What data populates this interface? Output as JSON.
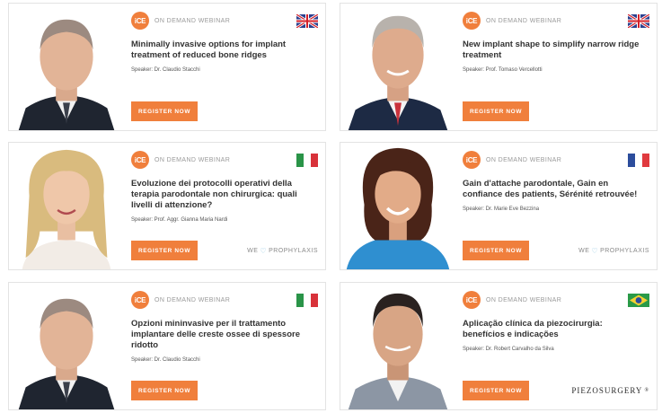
{
  "colors": {
    "accent_orange": "#f07f3c",
    "label_gray": "#9a9a9a",
    "card_border": "#e3e3e3"
  },
  "cards": [
    {
      "badge": "iCE",
      "label": "ON DEMAND WEBINAR",
      "flag": "uk-flag-icon",
      "title": "Minimally invasive options for implant treatment of reduced bone ridges",
      "speaker": "Speaker: Dr. Claudio Stacchi",
      "button": "REGISTER NOW",
      "brand_prefix": "",
      "brand_suffix": ""
    },
    {
      "badge": "iCE",
      "label": "ON DEMAND WEBINAR",
      "flag": "uk-flag-icon",
      "title": "New implant shape to simplify narrow ridge treatment",
      "speaker": "Speaker: Prof. Tomaso Vercellotti",
      "button": "REGISTER NOW",
      "brand_prefix": "",
      "brand_suffix": ""
    },
    {
      "badge": "iCE",
      "label": "ON DEMAND WEBINAR",
      "flag": "italy-flag-icon",
      "title": "Evoluzione dei protocolli operativi della terapia parodontale non chirurgica: quali livelli di attenzione?",
      "speaker": "Speaker: Prof. Aggr. Gianna Maria Nardi",
      "button": "REGISTER NOW",
      "brand_prefix": "WE",
      "brand_suffix": "PROPHYLAXIS"
    },
    {
      "badge": "iCE",
      "label": "ON DEMAND WEBINAR",
      "flag": "france-flag-icon",
      "title": "Gain d'attache parodontale, Gain en confiance des patients, Sérénité retrouvée!",
      "speaker": "Speaker: Dr. Marie Eve Bezzina",
      "button": "REGISTER NOW",
      "brand_prefix": "WE",
      "brand_suffix": "PROPHYLAXIS"
    },
    {
      "badge": "iCE",
      "label": "ON DEMAND WEBINAR",
      "flag": "italy-flag-icon",
      "title": "Opzioni mininvasive per il trattamento implantare delle creste ossee di spessore ridotto",
      "speaker": "Speaker: Dr. Claudio Stacchi",
      "button": "REGISTER NOW",
      "brand_prefix": "",
      "brand_suffix": ""
    },
    {
      "badge": "iCE",
      "label": "ON DEMAND WEBINAR",
      "flag": "brazil-flag-icon",
      "title": "Aplicação clínica da piezocirurgia: benefícios e indicações",
      "speaker": "Speaker: Dr. Robert Carvalho da Silva",
      "button": "REGISTER NOW",
      "brand_prefix": "PIEZOSURGERY",
      "brand_suffix": "®"
    }
  ]
}
